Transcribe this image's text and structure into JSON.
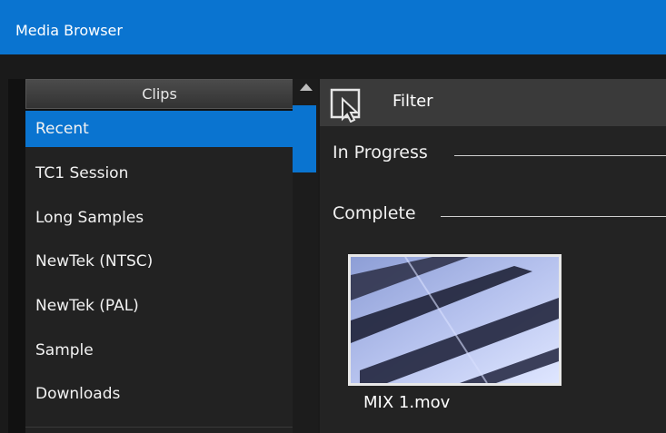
{
  "window": {
    "title": "Media Browser"
  },
  "sidebar": {
    "header": "Clips",
    "items": [
      {
        "label": "Recent",
        "selected": true
      },
      {
        "label": "TC1 Session",
        "selected": false
      },
      {
        "label": "Long Samples",
        "selected": false
      },
      {
        "label": "NewTek (NTSC)",
        "selected": false
      },
      {
        "label": "NewTek (PAL)",
        "selected": false
      },
      {
        "label": "Sample",
        "selected": false
      },
      {
        "label": "Downloads",
        "selected": false
      }
    ]
  },
  "toolbar": {
    "filter_label": "Filter",
    "filter_icon": "cursor-select-icon"
  },
  "main": {
    "sections": [
      {
        "label": "In Progress"
      },
      {
        "label": "Complete"
      }
    ],
    "clips": [
      {
        "name": "MIX 1.mov"
      }
    ]
  },
  "colors": {
    "accent": "#0a74d0",
    "background": "#1e1e1e"
  }
}
